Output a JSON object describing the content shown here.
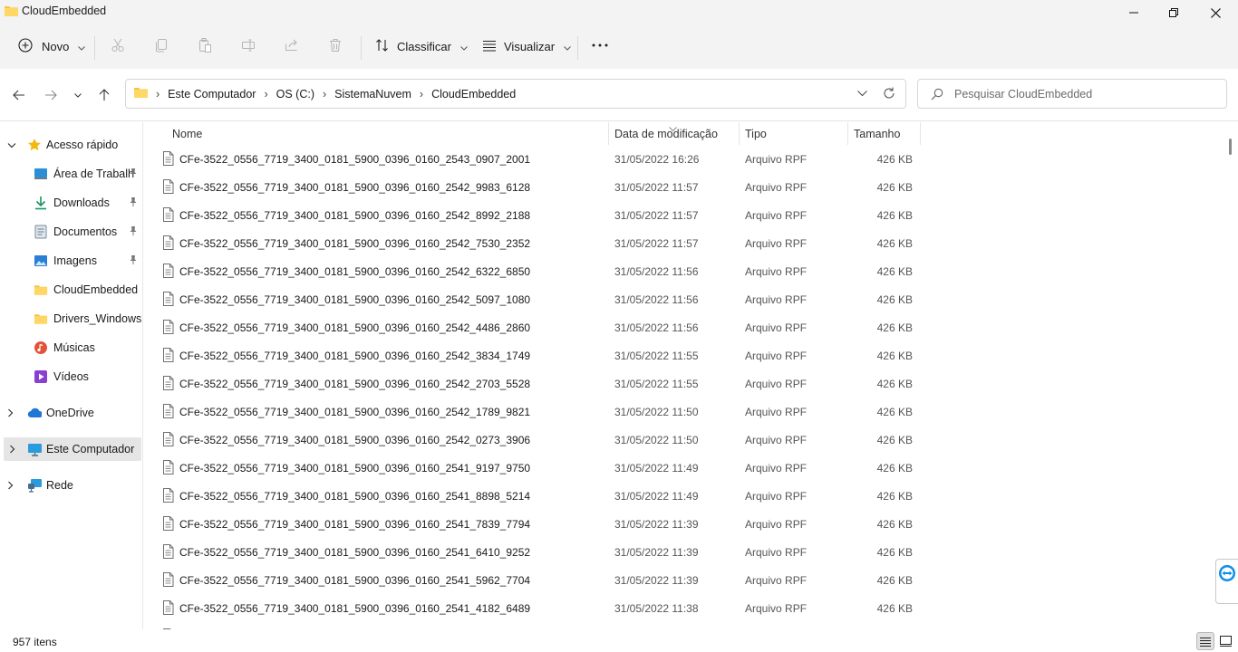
{
  "window": {
    "title": "CloudEmbedded",
    "controls": [
      "minimize",
      "maximize",
      "close"
    ]
  },
  "toolbar": {
    "new_label": "Novo",
    "sort_label": "Classificar",
    "view_label": "Visualizar",
    "more_label": "···",
    "disabled_icons": [
      "cut-icon",
      "copy-icon",
      "paste-icon",
      "rename-icon",
      "share-icon",
      "delete-icon"
    ]
  },
  "address": {
    "crumbs": [
      "Este Computador",
      "OS (C:)",
      "SistemaNuvem",
      "CloudEmbedded"
    ]
  },
  "search": {
    "placeholder": "Pesquisar CloudEmbedded",
    "value": ""
  },
  "sidebar": {
    "items": [
      {
        "label": "Acesso rápido",
        "icon": "star-icon",
        "expanded": true,
        "level": 0
      },
      {
        "label": "Área de Trabalh",
        "icon": "desktop-icon",
        "pinned": true,
        "level": 1
      },
      {
        "label": "Downloads",
        "icon": "download-icon",
        "pinned": true,
        "level": 1
      },
      {
        "label": "Documentos",
        "icon": "documents-icon",
        "pinned": true,
        "level": 1
      },
      {
        "label": "Imagens",
        "icon": "pictures-icon",
        "pinned": true,
        "level": 1
      },
      {
        "label": "CloudEmbedded",
        "icon": "folder-icon",
        "pinned": false,
        "level": 1
      },
      {
        "label": "Drivers_Windows",
        "icon": "folder-icon",
        "pinned": false,
        "level": 1
      },
      {
        "label": "Músicas",
        "icon": "music-icon",
        "pinned": false,
        "level": 1
      },
      {
        "label": "Vídeos",
        "icon": "videos-icon",
        "pinned": false,
        "level": 1
      },
      {
        "label": "OneDrive",
        "icon": "cloud-icon",
        "expanded": false,
        "level": 0
      },
      {
        "label": "Este Computador",
        "icon": "computer-icon",
        "expanded": false,
        "level": 0,
        "selected": true
      },
      {
        "label": "Rede",
        "icon": "network-icon",
        "expanded": false,
        "level": 0
      }
    ]
  },
  "filelist": {
    "columns": {
      "name": "Nome",
      "date": "Data de modificação",
      "type": "Tipo",
      "size": "Tamanho"
    },
    "rows": [
      {
        "name": "CFe-3522_0556_7719_3400_0181_5900_0396_0160_2543_0907_2001",
        "date": "31/05/2022 16:26",
        "type": "Arquivo RPF",
        "size": "426 KB"
      },
      {
        "name": "CFe-3522_0556_7719_3400_0181_5900_0396_0160_2542_9983_6128",
        "date": "31/05/2022 11:57",
        "type": "Arquivo RPF",
        "size": "426 KB"
      },
      {
        "name": "CFe-3522_0556_7719_3400_0181_5900_0396_0160_2542_8992_2188",
        "date": "31/05/2022 11:57",
        "type": "Arquivo RPF",
        "size": "426 KB"
      },
      {
        "name": "CFe-3522_0556_7719_3400_0181_5900_0396_0160_2542_7530_2352",
        "date": "31/05/2022 11:57",
        "type": "Arquivo RPF",
        "size": "426 KB"
      },
      {
        "name": "CFe-3522_0556_7719_3400_0181_5900_0396_0160_2542_6322_6850",
        "date": "31/05/2022 11:56",
        "type": "Arquivo RPF",
        "size": "426 KB"
      },
      {
        "name": "CFe-3522_0556_7719_3400_0181_5900_0396_0160_2542_5097_1080",
        "date": "31/05/2022 11:56",
        "type": "Arquivo RPF",
        "size": "426 KB"
      },
      {
        "name": "CFe-3522_0556_7719_3400_0181_5900_0396_0160_2542_4486_2860",
        "date": "31/05/2022 11:56",
        "type": "Arquivo RPF",
        "size": "426 KB"
      },
      {
        "name": "CFe-3522_0556_7719_3400_0181_5900_0396_0160_2542_3834_1749",
        "date": "31/05/2022 11:55",
        "type": "Arquivo RPF",
        "size": "426 KB"
      },
      {
        "name": "CFe-3522_0556_7719_3400_0181_5900_0396_0160_2542_2703_5528",
        "date": "31/05/2022 11:55",
        "type": "Arquivo RPF",
        "size": "426 KB"
      },
      {
        "name": "CFe-3522_0556_7719_3400_0181_5900_0396_0160_2542_1789_9821",
        "date": "31/05/2022 11:50",
        "type": "Arquivo RPF",
        "size": "426 KB"
      },
      {
        "name": "CFe-3522_0556_7719_3400_0181_5900_0396_0160_2542_0273_3906",
        "date": "31/05/2022 11:50",
        "type": "Arquivo RPF",
        "size": "426 KB"
      },
      {
        "name": "CFe-3522_0556_7719_3400_0181_5900_0396_0160_2541_9197_9750",
        "date": "31/05/2022 11:49",
        "type": "Arquivo RPF",
        "size": "426 KB"
      },
      {
        "name": "CFe-3522_0556_7719_3400_0181_5900_0396_0160_2541_8898_5214",
        "date": "31/05/2022 11:49",
        "type": "Arquivo RPF",
        "size": "426 KB"
      },
      {
        "name": "CFe-3522_0556_7719_3400_0181_5900_0396_0160_2541_7839_7794",
        "date": "31/05/2022 11:39",
        "type": "Arquivo RPF",
        "size": "426 KB"
      },
      {
        "name": "CFe-3522_0556_7719_3400_0181_5900_0396_0160_2541_6410_9252",
        "date": "31/05/2022 11:39",
        "type": "Arquivo RPF",
        "size": "426 KB"
      },
      {
        "name": "CFe-3522_0556_7719_3400_0181_5900_0396_0160_2541_5962_7704",
        "date": "31/05/2022 11:39",
        "type": "Arquivo RPF",
        "size": "426 KB"
      },
      {
        "name": "CFe-3522_0556_7719_3400_0181_5900_0396_0160_2541_4182_6489",
        "date": "31/05/2022 11:38",
        "type": "Arquivo RPF",
        "size": "426 KB"
      }
    ]
  },
  "status": {
    "count": "957 itens",
    "view_modes": [
      "details-view-icon",
      "tiles-view-icon"
    ],
    "active_view": "details-view-icon"
  },
  "colors": {
    "folder": "#f5c342",
    "chrome": "#f3f3f3",
    "selected": "#e5e5e5",
    "accent": "#0067c0"
  }
}
